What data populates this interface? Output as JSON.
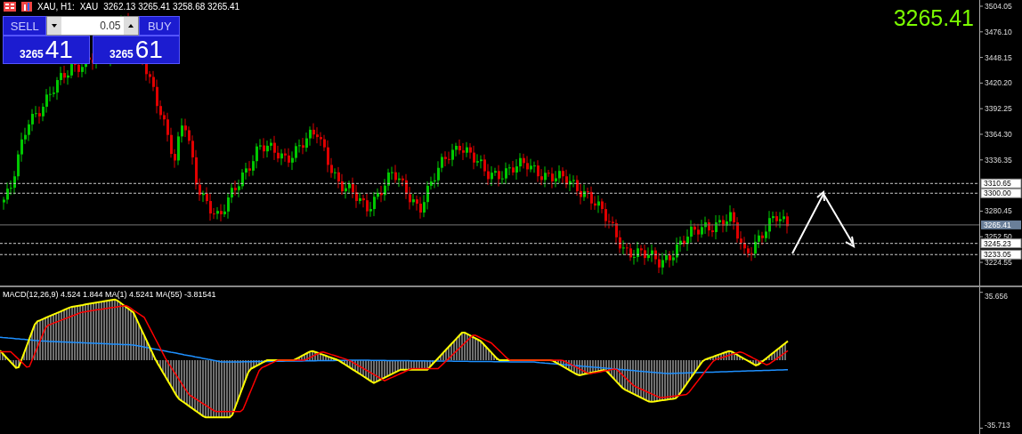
{
  "chart_header": {
    "title": "XAU, H1:",
    "symbol": "XAU",
    "ohlc": "3262.13 3265.41 3258.68 3265.41"
  },
  "trade_panel": {
    "sell_label": "SELL",
    "buy_label": "BUY",
    "lot": "0.05",
    "sell_price_prefix": "3265",
    "sell_price_main": "41",
    "buy_price_prefix": "3265",
    "buy_price_main": "61"
  },
  "current_price": "3265.41",
  "price_axis": {
    "labels": [
      "3504.05",
      "3476.10",
      "3448.15",
      "3420.20",
      "3392.25",
      "3364.30",
      "3336.35",
      "3280.45",
      "3252.50",
      "3224.55"
    ],
    "levels": [
      {
        "label": "3310.65",
        "kind": "level"
      },
      {
        "label": "3300.00",
        "kind": "level"
      },
      {
        "label": "3265.41",
        "kind": "current"
      },
      {
        "label": "3245.23",
        "kind": "level"
      },
      {
        "label": "3233.05",
        "kind": "level"
      }
    ]
  },
  "macd": {
    "legend": "MACD(12,26,9) 4.524 1.844 MA(1) 4.5241 MA(55) -3.81541",
    "axis_labels": [
      "35.656",
      "-35.713"
    ]
  }
}
